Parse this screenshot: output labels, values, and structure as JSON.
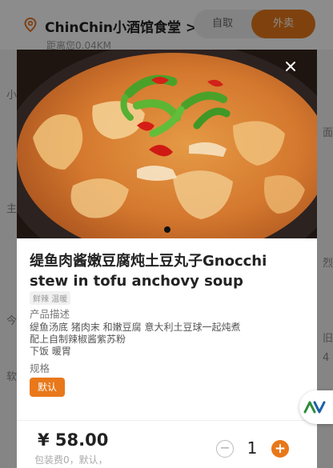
{
  "header": {
    "store_name": "ChinChin小酒馆食堂 >",
    "distance": "距离您0.04KM",
    "location_icon": "location-pin-icon",
    "pickup_label": "自取",
    "delivery_label": "外卖"
  },
  "background_labels": [
    "小",
    "主",
    "今",
    "软",
    "面",
    "烈",
    "旧",
    "4"
  ],
  "dish": {
    "title": "缇鱼肉酱嫩豆腐炖土豆丸子Gnocchi stew in tofu anchovy soup",
    "tags": "鲜辣 温暖",
    "desc_label": "产品描述",
    "desc_text": "缇鱼汤底 猪肉末 和嫩豆腐 意大利土豆球一起炖煮\n配上自制辣椒酱紫苏粉\n下饭 暖胃",
    "spec_label": "规格",
    "spec_option": "默认",
    "close_icon": "close-icon"
  },
  "footer": {
    "price": "¥ 58.00",
    "fee_text": "包装费0，默认，",
    "quantity": "1",
    "minus_label": "−",
    "plus_label": "+"
  },
  "colors": {
    "accent": "#e8781a"
  }
}
